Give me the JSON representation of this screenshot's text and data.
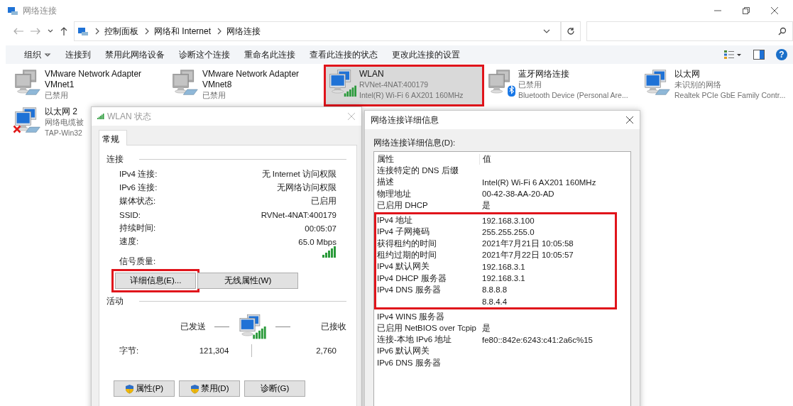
{
  "window": {
    "title": "网络连接"
  },
  "address_bar": {
    "breadcrumb": [
      "控制面板",
      "网络和 Internet",
      "网络连接"
    ]
  },
  "command_bar": {
    "items": [
      {
        "label": "组织",
        "dropdown": true
      },
      {
        "label": "连接到",
        "dropdown": false
      },
      {
        "label": "禁用此网络设备",
        "dropdown": false
      },
      {
        "label": "诊断这个连接",
        "dropdown": false
      },
      {
        "label": "重命名此连接",
        "dropdown": false
      },
      {
        "label": "查看此连接的状态",
        "dropdown": false
      },
      {
        "label": "更改此连接的设置",
        "dropdown": false
      }
    ],
    "help": "?"
  },
  "adapters": [
    {
      "name": "VMware Network Adapter VMnet1",
      "details": [
        "已禁用"
      ],
      "kind": "ethernet",
      "disabled": true,
      "unplugged": false,
      "selected": false,
      "highlighted": false
    },
    {
      "name": "VMware Network Adapter VMnet8",
      "details": [
        "已禁用"
      ],
      "kind": "ethernet",
      "disabled": true,
      "unplugged": false,
      "selected": false,
      "highlighted": false
    },
    {
      "name": "WLAN",
      "details": [
        "RVNet-4NAT:400179",
        "Intel(R) Wi-Fi 6 AX201 160MHz"
      ],
      "kind": "wifi",
      "disabled": false,
      "unplugged": false,
      "selected": true,
      "highlighted": true
    },
    {
      "name": "蓝牙网络连接",
      "details": [
        "已禁用",
        "Bluetooth Device (Personal Are..."
      ],
      "kind": "bluetooth",
      "disabled": true,
      "unplugged": false,
      "selected": false,
      "highlighted": false
    },
    {
      "name": "以太网",
      "details": [
        "未识别的网络",
        "Realtek PCIe GbE Family Contr..."
      ],
      "kind": "ethernet",
      "disabled": false,
      "unplugged": false,
      "selected": false,
      "highlighted": false
    },
    {
      "name": "以太网 2",
      "details": [
        "网络电缆被",
        "TAP-Win32"
      ],
      "kind": "ethernet",
      "disabled": false,
      "unplugged": true,
      "selected": false,
      "highlighted": false
    }
  ],
  "status_dialog": {
    "title": "WLAN 状态",
    "tabs": [
      {
        "label": "常规",
        "selected": true
      }
    ],
    "connection_heading": "连接",
    "fields": [
      {
        "label": "IPv4 连接:",
        "value": "无 Internet 访问权限"
      },
      {
        "label": "IPv6 连接:",
        "value": "无网络访问权限"
      },
      {
        "label": "媒体状态:",
        "value": "已启用"
      },
      {
        "label": "SSID:",
        "value": "RVNet-4NAT:400179"
      },
      {
        "label": "持续时间:",
        "value": "00:05:07"
      },
      {
        "label": "速度:",
        "value": "65.0 Mbps"
      }
    ],
    "signal_label": "信号质量:",
    "buttons": [
      {
        "label": "详细信息(E)...",
        "highlighted": true
      },
      {
        "label": "无线属性(W)",
        "highlighted": false
      }
    ],
    "activity_heading": "活动",
    "sent_label": "已发送",
    "received_label": "已接收",
    "bytes_label": "字节:",
    "bytes_sent": "121,304",
    "bytes_received": "2,760",
    "footer_buttons": [
      {
        "label": "属性(P)",
        "shield": true
      },
      {
        "label": "禁用(D)",
        "shield": true
      },
      {
        "label": "诊断(G)",
        "shield": false
      }
    ]
  },
  "details_dialog": {
    "title": "网络连接详细信息",
    "list_label": "网络连接详细信息(D):",
    "columns": [
      "属性",
      "值"
    ],
    "groups": [
      {
        "highlighted": false,
        "rows": [
          {
            "property": "连接特定的 DNS 后缀"
          },
          {
            "property": "描述",
            "value": "Intel(R) Wi-Fi 6 AX201 160MHz"
          },
          {
            "property": "物理地址",
            "value": "00-42-38-AA-20-AD"
          },
          {
            "property": "已启用 DHCP",
            "value": "是"
          }
        ]
      },
      {
        "highlighted": true,
        "rows": [
          {
            "property": "IPv4 地址",
            "value": "192.168.3.100"
          },
          {
            "property": "IPv4 子网掩码",
            "value": "255.255.255.0"
          },
          {
            "property": "获得租约的时间",
            "value": "2021年7月21日 10:05:58"
          },
          {
            "property": "租约过期的时间",
            "value": "2021年7月22日 10:05:57"
          },
          {
            "property": "IPv4 默认网关",
            "value": "192.168.3.1"
          },
          {
            "property": "IPv4 DHCP 服务器",
            "value": "192.168.3.1"
          },
          {
            "property": "IPv4 DNS 服务器",
            "value": "8.8.8.8"
          },
          {
            "value": "8.8.4.4"
          }
        ]
      },
      {
        "highlighted": false,
        "rows": [
          {
            "property": "IPv4 WINS 服务器"
          },
          {
            "property": "已启用 NetBIOS over Tcpip",
            "value": "是"
          },
          {
            "property": "连接-本地 IPv6 地址",
            "value": "fe80::842e:6243:c41:2a6c%15"
          },
          {
            "property": "IPv6 默认网关"
          },
          {
            "property": "IPv6 DNS 服务器"
          }
        ]
      }
    ]
  }
}
